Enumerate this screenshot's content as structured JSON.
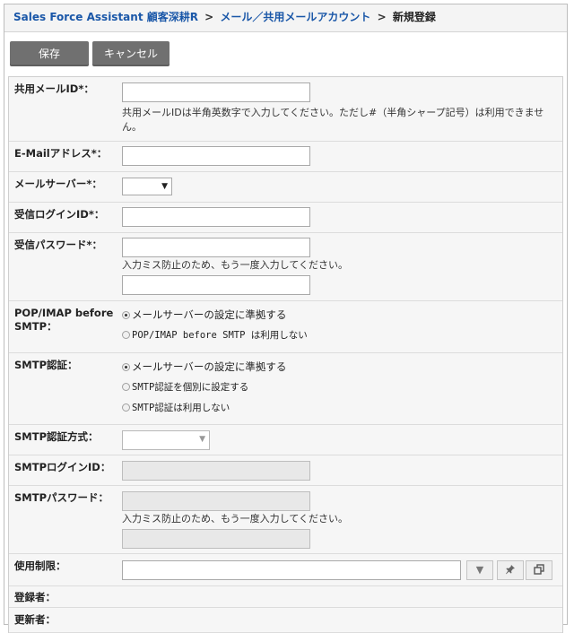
{
  "breadcrumb": {
    "app": "Sales Force Assistant 顧客深耕R",
    "section": "メール／共用メールアカウント",
    "current": "新規登録",
    "separator": ">"
  },
  "toolbar": {
    "save_label": "保存",
    "cancel_label": "キャンセル"
  },
  "form": {
    "shared_mail_id": {
      "label": "共用メールID*：",
      "value": "",
      "hint": "共用メールIDは半角英数字で入力してください。ただし#（半角シャープ記号）は利用できません。"
    },
    "email": {
      "label": "E-Mailアドレス*：",
      "value": ""
    },
    "mail_server": {
      "label": "メールサーバー*：",
      "value": ""
    },
    "receive_login_id": {
      "label": "受信ログインID*：",
      "value": ""
    },
    "receive_password": {
      "label": "受信パスワード*：",
      "value": "",
      "confirm_hint": "入力ミス防止のため、もう一度入力してください。"
    },
    "pop_before_smtp": {
      "label": "POP/IMAP before SMTP：",
      "options": [
        "メールサーバーの設定に準拠する",
        "POP/IMAP before SMTP は利用しない"
      ],
      "selected": 0
    },
    "smtp_auth": {
      "label": "SMTP認証：",
      "options": [
        "メールサーバーの設定に準拠する",
        "SMTP認証を個別に設定する",
        "SMTP認証は利用しない"
      ],
      "selected": 0
    },
    "smtp_auth_method": {
      "label": "SMTP認証方式：",
      "value": ""
    },
    "smtp_login_id": {
      "label": "SMTPログインID：",
      "value": ""
    },
    "smtp_password": {
      "label": "SMTPパスワード：",
      "value": "",
      "confirm_hint": "入力ミス防止のため、もう一度入力してください。"
    },
    "usage_restriction": {
      "label": "使用制限：",
      "value": ""
    },
    "registered_by": {
      "label": "登録者：",
      "value": ""
    },
    "updated_by": {
      "label": "更新者：",
      "value": ""
    }
  },
  "icons": {
    "dropdown": "chevron-down-icon",
    "pin": "pin-icon",
    "copy": "copy-icon"
  }
}
